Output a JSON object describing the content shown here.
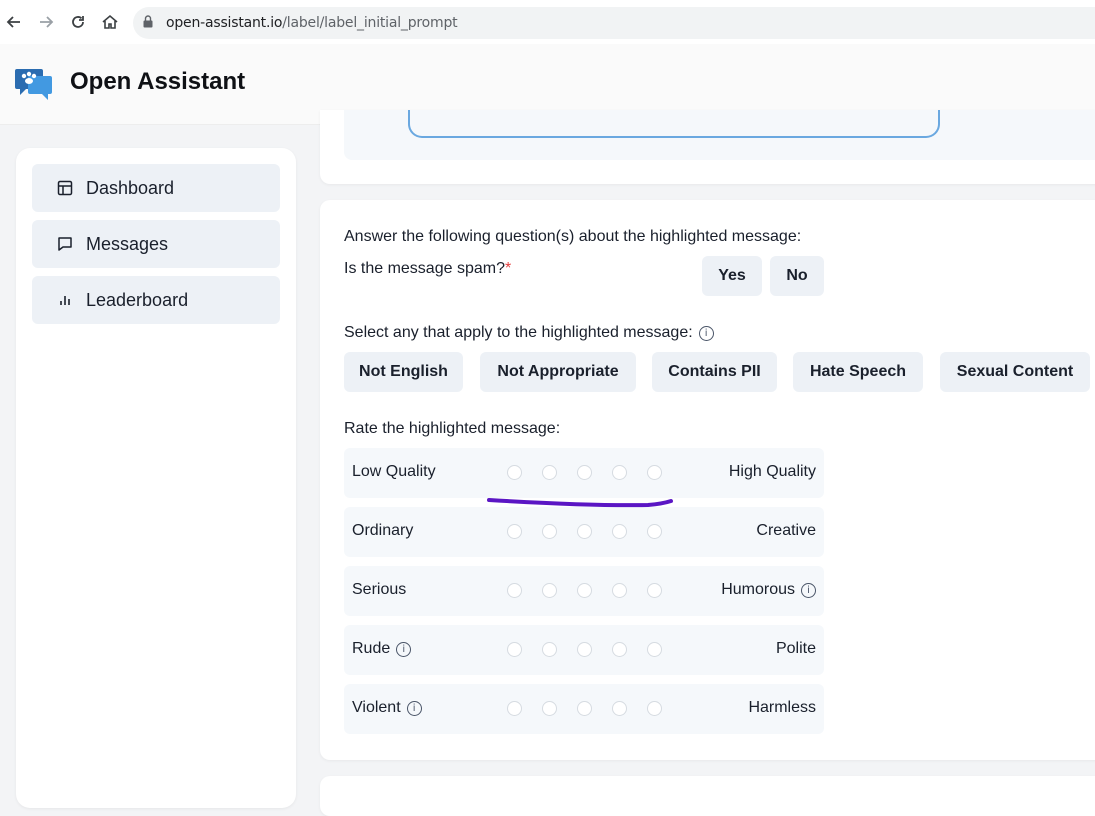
{
  "browser": {
    "url_host": "open-assistant.io",
    "url_path": "/label/label_initial_prompt"
  },
  "app": {
    "title": "Open Assistant"
  },
  "sidebar": {
    "items": [
      {
        "label": "Dashboard",
        "icon": "layout-icon"
      },
      {
        "label": "Messages",
        "icon": "message-icon"
      },
      {
        "label": "Leaderboard",
        "icon": "bar-chart-icon"
      }
    ]
  },
  "form": {
    "intro": "Answer the following question(s) about the highlighted message:",
    "spam_question": "Is the message spam?",
    "required_mark": "*",
    "yes_label": "Yes",
    "no_label": "No",
    "select_prompt": "Select any that apply to the highlighted message:",
    "flags": [
      "Not English",
      "Not Appropriate",
      "Contains PII",
      "Hate Speech",
      "Sexual Content"
    ],
    "rate_prompt": "Rate the highlighted message:",
    "ratings": [
      {
        "low": "Low Quality",
        "high": "High Quality"
      },
      {
        "low": "Ordinary",
        "high": "Creative"
      },
      {
        "low": "Serious",
        "high": "Humorous"
      },
      {
        "low": "Rude",
        "high": "Polite"
      },
      {
        "low": "Violent",
        "high": "Harmless"
      }
    ],
    "info_glyph": "i"
  },
  "colors": {
    "accent": "#3182ce",
    "required": "#e53e3e",
    "annotation": "#5b16c4"
  }
}
